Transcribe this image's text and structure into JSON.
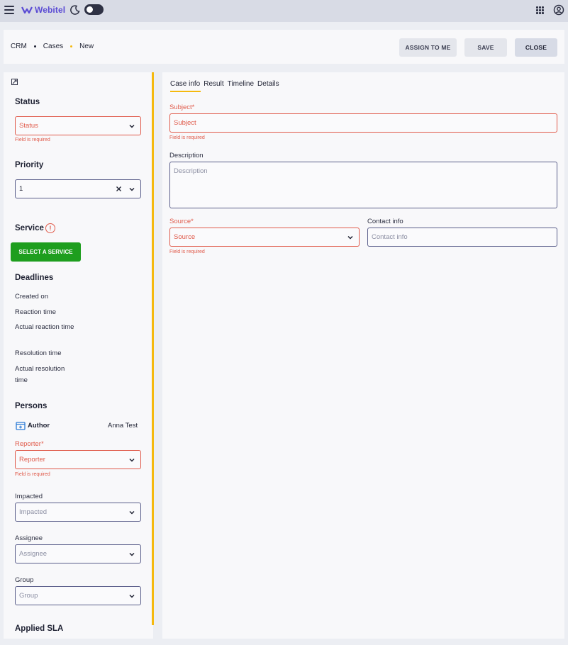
{
  "app": {
    "logo_text": "Webitel",
    "brand_color": "#5a4bd4"
  },
  "topbar": {
    "menu_icon": "hamburger-icon",
    "theme_icon": "moon-icon",
    "apps_icon": "apps-grid-icon",
    "account_icon": "account-icon"
  },
  "breadcrumb": [
    "CRM",
    "Cases",
    "New"
  ],
  "actions": {
    "assign": "ASSIGN TO ME",
    "save": "SAVE",
    "close": "CLOSE"
  },
  "left": {
    "expand_icon": "expand-icon",
    "status": {
      "title": "Status",
      "placeholder": "Status",
      "error": "Field is required"
    },
    "priority": {
      "title": "Priority",
      "value": "1"
    },
    "service": {
      "title": "Service",
      "warn_glyph": "!",
      "button": "SELECT A SERVICE"
    },
    "deadlines": {
      "title": "Deadlines",
      "items": [
        "Created on",
        "Reaction time",
        "Actual reaction time",
        "Resolution time",
        "Actual resolution time"
      ]
    },
    "persons": {
      "title": "Persons",
      "author_label": "Author",
      "author_value": "Anna Test",
      "reporter": {
        "label": "Reporter*",
        "placeholder": "Reporter",
        "error": "Field is required"
      },
      "impacted": {
        "label": "Impacted",
        "placeholder": "Impacted"
      },
      "assignee": {
        "label": "Assignee",
        "placeholder": "Assignee"
      },
      "group": {
        "label": "Group",
        "placeholder": "Group"
      }
    },
    "applied_sla": {
      "title": "Applied SLA"
    }
  },
  "right": {
    "tabs": [
      "Case info",
      "Result",
      "Timeline",
      "Details"
    ],
    "subject": {
      "label": "Subject*",
      "placeholder": "Subject",
      "error": "Field is required"
    },
    "description": {
      "label": "Description",
      "placeholder": "Description"
    },
    "source": {
      "label": "Source*",
      "placeholder": "Source",
      "error": "Field is required"
    },
    "contact": {
      "label": "Contact info",
      "placeholder": "Contact info"
    }
  },
  "colors": {
    "accent": "#f5b90e",
    "error": "#e05a4a",
    "success": "#1e9e1e",
    "field_border": "#5a5e8a"
  }
}
